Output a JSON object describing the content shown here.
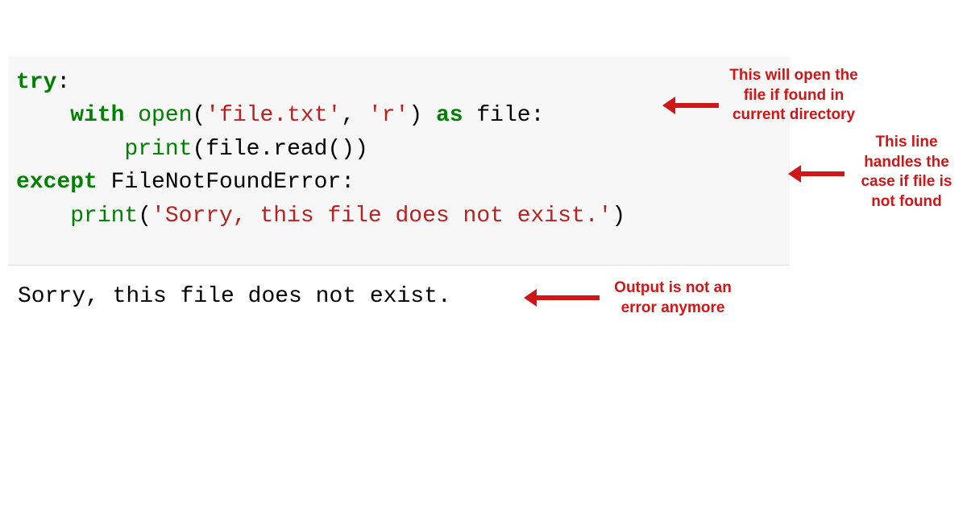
{
  "code": {
    "line1_kw": "try",
    "line1_punct": ":",
    "line2_kw1": "with",
    "line2_fn": "open",
    "line2_p1": "(",
    "line2_str1": "'file.txt'",
    "line2_comma": ", ",
    "line2_str2": "'r'",
    "line2_p2": ") ",
    "line2_kw2": "as",
    "line2_id": " file:",
    "line3_fn": "print",
    "line3_p1": "(file",
    "line3_dot": ".",
    "line3_m": "read",
    "line3_p2": "())",
    "line4_kw": "except",
    "line4_id": " FileNotFoundError:",
    "line5_fn": "print",
    "line5_p1": "(",
    "line5_str": "'Sorry, this file does not exist.'",
    "line5_p2": ")"
  },
  "output": "Sorry, this file does not exist.",
  "annotations": {
    "a1": "This will open the file if found in current directory",
    "a2": "This line handles the case if file is not found",
    "a3": "Output is not an error anymore"
  }
}
